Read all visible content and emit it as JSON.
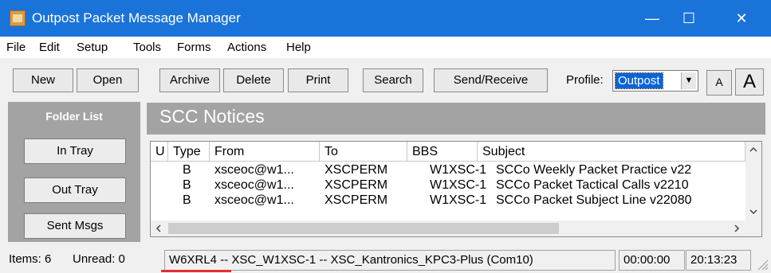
{
  "window": {
    "title": "Outpost Packet Message Manager",
    "minimize": "—",
    "maximize": "☐",
    "close": "✕"
  },
  "menu": [
    "File",
    "Edit",
    "Setup",
    "Tools",
    "Forms",
    "Actions",
    "Help"
  ],
  "toolbar": {
    "new": "New",
    "open": "Open",
    "archive": "Archive",
    "delete": "Delete",
    "print": "Print",
    "search": "Search",
    "send_receive": "Send/Receive",
    "profile_label": "Profile:",
    "profile_value": "Outpost",
    "font_small": "A",
    "font_large": "A"
  },
  "folders": {
    "title": "Folder List",
    "items": [
      "In Tray",
      "Out Tray",
      "Sent Msgs"
    ]
  },
  "current_folder": "SCC Notices",
  "table": {
    "columns": [
      "U",
      "Type",
      "From",
      "To",
      "BBS",
      "Subject"
    ],
    "rows": [
      {
        "u": "",
        "type": "B",
        "from": "xsceoc@w1...",
        "to": "XSCPERM",
        "bbs": "W1XSC-1",
        "subject": "SCCo Weekly Packet Practice v22"
      },
      {
        "u": "",
        "type": "B",
        "from": "xsceoc@w1...",
        "to": "XSCPERM",
        "bbs": "W1XSC-1",
        "subject": "SCCo Packet Tactical Calls v2210"
      },
      {
        "u": "",
        "type": "B",
        "from": "xsceoc@w1...",
        "to": "XSCPERM",
        "bbs": "W1XSC-1",
        "subject": "SCCo Packet Subject Line v22080"
      }
    ]
  },
  "status": {
    "items": "Items: 6",
    "unread": "Unread: 0",
    "connection": "W6XRL4 -- XSC_W1XSC-1 -- XSC_Kantronics_KPC3-Plus (Com10)",
    "timer": "00:00:00",
    "clock": "20:13:23"
  },
  "icons": {
    "app": "outpost-app-icon",
    "dropdown": "chevron-down-icon",
    "scroll_up": "chevron-up-icon",
    "scroll_down": "chevron-down-icon",
    "scroll_left": "chevron-left-icon",
    "scroll_right": "chevron-right-icon"
  },
  "colors": {
    "titlebar": "#1a73d9",
    "panel_gray": "#a3a3a3",
    "selection": "#0a64d8",
    "underline_mark": "#e03030"
  }
}
